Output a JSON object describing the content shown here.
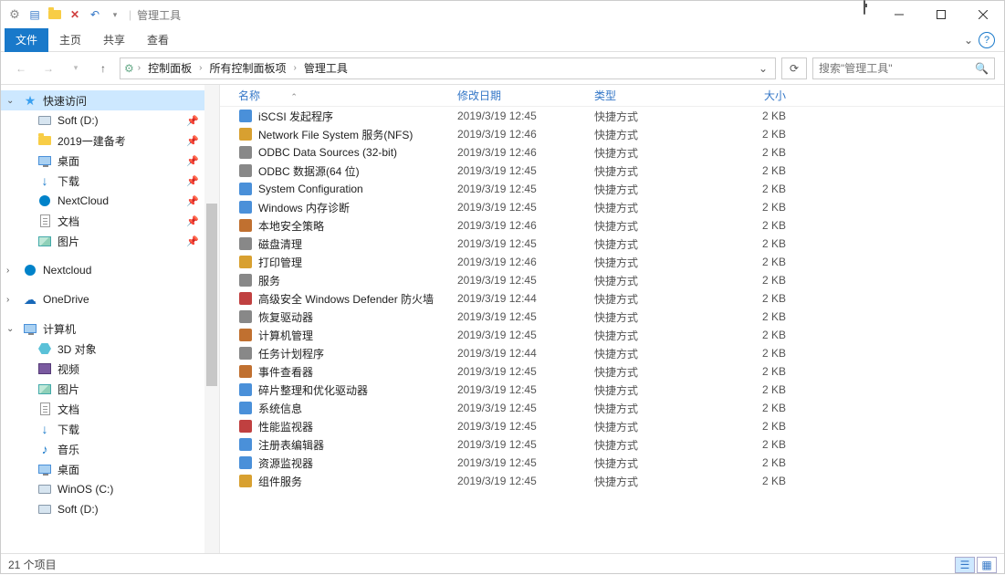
{
  "window": {
    "title": "管理工具",
    "qat_sep": "|"
  },
  "ribbon": {
    "file": "文件",
    "home": "主页",
    "share": "共享",
    "view": "查看"
  },
  "address": {
    "crumbs": [
      "控制面板",
      "所有控制面板项",
      "管理工具"
    ],
    "search_placeholder": "搜索\"管理工具\""
  },
  "sidebar": {
    "quick_access": "快速访问",
    "items_pinned": [
      {
        "label": "Soft (D:)",
        "icon": "drive"
      },
      {
        "label": "2019一建备考",
        "icon": "folder"
      },
      {
        "label": "桌面",
        "icon": "desktop"
      },
      {
        "label": "下载",
        "icon": "download"
      },
      {
        "label": "NextCloud",
        "icon": "nextcloud"
      },
      {
        "label": "文档",
        "icon": "doc"
      },
      {
        "label": "图片",
        "icon": "pic"
      }
    ],
    "nextcloud": "Nextcloud",
    "onedrive": "OneDrive",
    "computer": "计算机",
    "computer_items": [
      {
        "label": "3D 对象",
        "icon": "3d"
      },
      {
        "label": "视频",
        "icon": "film"
      },
      {
        "label": "图片",
        "icon": "pic"
      },
      {
        "label": "文档",
        "icon": "doc"
      },
      {
        "label": "下载",
        "icon": "download"
      },
      {
        "label": "音乐",
        "icon": "music"
      },
      {
        "label": "桌面",
        "icon": "desktop"
      },
      {
        "label": "WinOS (C:)",
        "icon": "drive"
      },
      {
        "label": "Soft (D:)",
        "icon": "drive"
      }
    ]
  },
  "columns": {
    "name": "名称",
    "date": "修改日期",
    "type": "类型",
    "size": "大小"
  },
  "type_shortcut": "快捷方式",
  "rows": [
    {
      "name": "iSCSI 发起程序",
      "date": "2019/3/19 12:45",
      "size": "2 KB",
      "icon": "globe"
    },
    {
      "name": "Network File System 服务(NFS)",
      "date": "2019/3/19 12:46",
      "size": "2 KB",
      "icon": "folder-gear"
    },
    {
      "name": "ODBC Data Sources (32-bit)",
      "date": "2019/3/19 12:46",
      "size": "2 KB",
      "icon": "odbc"
    },
    {
      "name": "ODBC 数据源(64 位)",
      "date": "2019/3/19 12:45",
      "size": "2 KB",
      "icon": "odbc"
    },
    {
      "name": "System Configuration",
      "date": "2019/3/19 12:45",
      "size": "2 KB",
      "icon": "sysconf"
    },
    {
      "name": "Windows 内存诊断",
      "date": "2019/3/19 12:45",
      "size": "2 KB",
      "icon": "memdiag"
    },
    {
      "name": "本地安全策略",
      "date": "2019/3/19 12:46",
      "size": "2 KB",
      "icon": "secpol"
    },
    {
      "name": "磁盘清理",
      "date": "2019/3/19 12:45",
      "size": "2 KB",
      "icon": "cleanmgr"
    },
    {
      "name": "打印管理",
      "date": "2019/3/19 12:46",
      "size": "2 KB",
      "icon": "printmgmt"
    },
    {
      "name": "服务",
      "date": "2019/3/19 12:45",
      "size": "2 KB",
      "icon": "services"
    },
    {
      "name": "高级安全 Windows Defender 防火墙",
      "date": "2019/3/19 12:44",
      "size": "2 KB",
      "icon": "firewall"
    },
    {
      "name": "恢复驱动器",
      "date": "2019/3/19 12:45",
      "size": "2 KB",
      "icon": "recovery"
    },
    {
      "name": "计算机管理",
      "date": "2019/3/19 12:45",
      "size": "2 KB",
      "icon": "compmgmt"
    },
    {
      "name": "任务计划程序",
      "date": "2019/3/19 12:44",
      "size": "2 KB",
      "icon": "tasksch"
    },
    {
      "name": "事件查看器",
      "date": "2019/3/19 12:45",
      "size": "2 KB",
      "icon": "eventvwr"
    },
    {
      "name": "碎片整理和优化驱动器",
      "date": "2019/3/19 12:45",
      "size": "2 KB",
      "icon": "defrag"
    },
    {
      "name": "系统信息",
      "date": "2019/3/19 12:45",
      "size": "2 KB",
      "icon": "sysinfo"
    },
    {
      "name": "性能监视器",
      "date": "2019/3/19 12:45",
      "size": "2 KB",
      "icon": "perfmon"
    },
    {
      "name": "注册表编辑器",
      "date": "2019/3/19 12:45",
      "size": "2 KB",
      "icon": "regedit"
    },
    {
      "name": "资源监视器",
      "date": "2019/3/19 12:45",
      "size": "2 KB",
      "icon": "resmon"
    },
    {
      "name": "组件服务",
      "date": "2019/3/19 12:45",
      "size": "2 KB",
      "icon": "comsvc"
    }
  ],
  "status": {
    "count_label": "21 个项目"
  }
}
